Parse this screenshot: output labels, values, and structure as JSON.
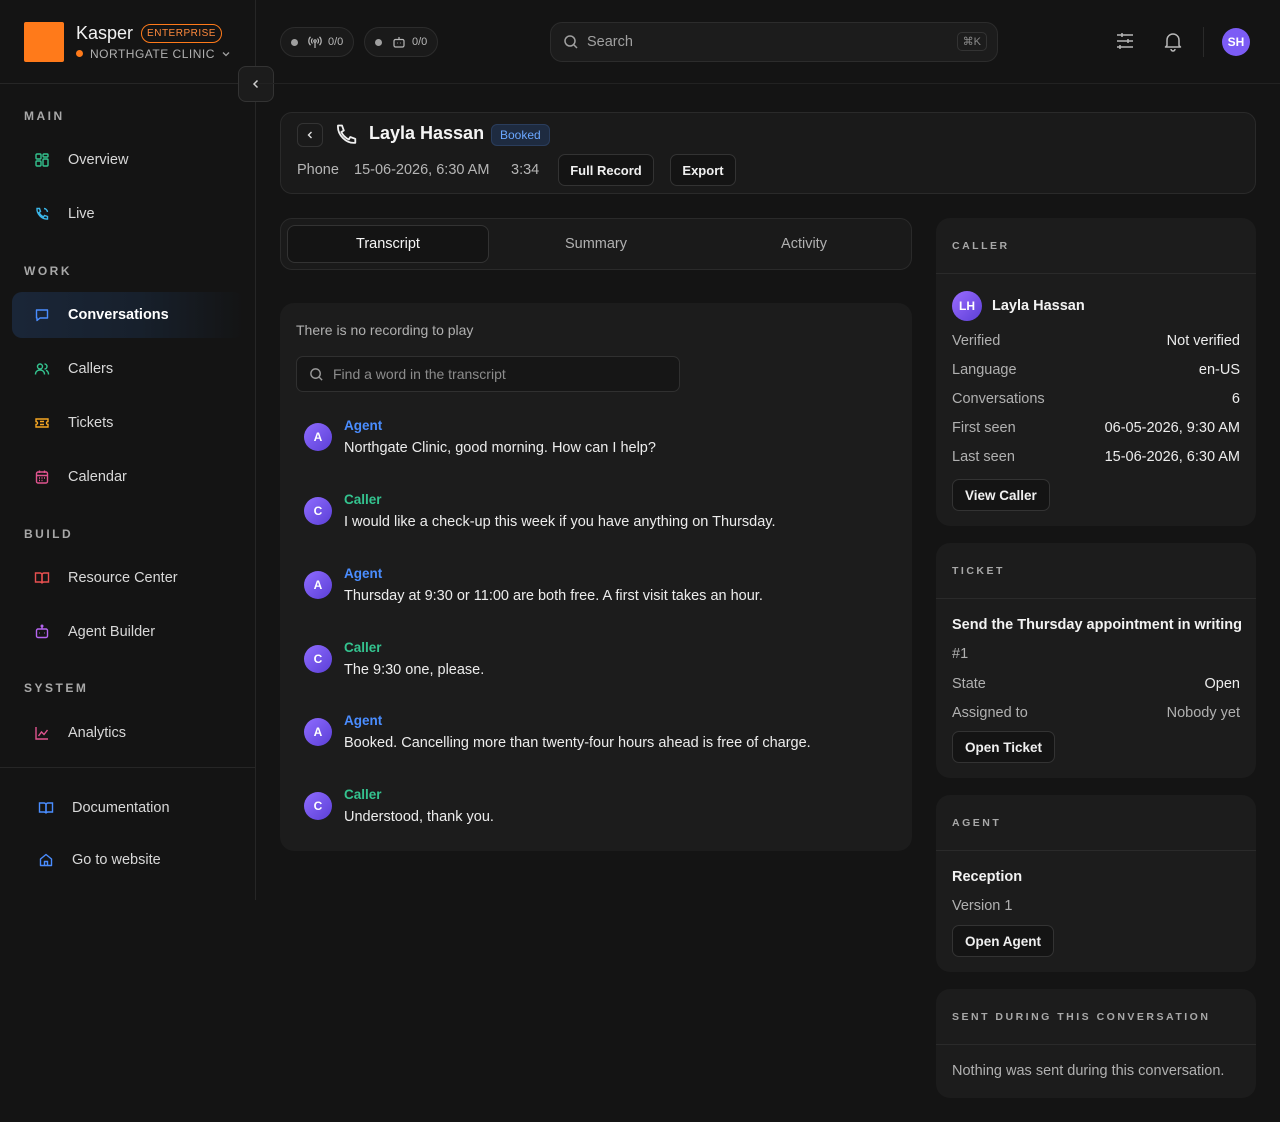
{
  "brand": {
    "name": "Kasper",
    "badge": "ENTERPRISE",
    "workspace": "NORTHGATE CLINIC"
  },
  "nav": {
    "sections": {
      "main": "MAIN",
      "work": "WORK",
      "build": "BUILD",
      "system": "SYSTEM"
    },
    "items": {
      "overview": "Overview",
      "live": "Live",
      "conversations": "Conversations",
      "callers": "Callers",
      "tickets": "Tickets",
      "calendar": "Calendar",
      "resource_center": "Resource Center",
      "agent_builder": "Agent Builder",
      "analytics": "Analytics",
      "documentation": "Documentation",
      "go_to_website": "Go to website"
    },
    "active": "conversations"
  },
  "topbar": {
    "calls_counter": "0/0",
    "agents_counter": "0/0",
    "search_placeholder": "Search",
    "search_shortcut": "⌘K",
    "user_initials": "SH"
  },
  "conversation": {
    "caller_name": "Layla Hassan",
    "status": "Booked",
    "channel": "Phone",
    "datetime": "15-06-2026, 6:30 AM",
    "duration": "3:34",
    "full_record_label": "Full Record",
    "export_label": "Export"
  },
  "tabs": [
    "Transcript",
    "Summary",
    "Activity"
  ],
  "transcript": {
    "no_recording": "There is no recording to play",
    "find_placeholder": "Find a word in the transcript",
    "messages": [
      {
        "initial": "A",
        "role": "Agent",
        "text": "Northgate Clinic, good morning. How can I help?"
      },
      {
        "initial": "C",
        "role": "Caller",
        "text": "I would like a check-up this week if you have anything on Thursday."
      },
      {
        "initial": "A",
        "role": "Agent",
        "text": "Thursday at 9:30 or 11:00 are both free. A first visit takes an hour."
      },
      {
        "initial": "C",
        "role": "Caller",
        "text": "The 9:30 one, please."
      },
      {
        "initial": "A",
        "role": "Agent",
        "text": "Booked. Cancelling more than twenty-four hours ahead is free of charge."
      },
      {
        "initial": "C",
        "role": "Caller",
        "text": "Understood, thank you."
      }
    ]
  },
  "caller_card": {
    "title": "CALLER",
    "initials": "LH",
    "name": "Layla Hassan",
    "rows": [
      {
        "k": "Verified",
        "v": "Not verified"
      },
      {
        "k": "Language",
        "v": "en-US"
      },
      {
        "k": "Conversations",
        "v": "6"
      },
      {
        "k": "First seen",
        "v": "06-05-2026, 9:30 AM"
      },
      {
        "k": "Last seen",
        "v": "15-06-2026, 6:30 AM"
      }
    ],
    "button": "View Caller"
  },
  "ticket_card": {
    "title": "TICKET",
    "subject": "Send the Thursday appointment in writing",
    "number": "#1",
    "rows": [
      {
        "k": "State",
        "v": "Open"
      },
      {
        "k": "Assigned to",
        "v": "Nobody yet"
      }
    ],
    "button": "Open Ticket"
  },
  "agent_card": {
    "title": "AGENT",
    "name": "Reception",
    "version": "Version 1",
    "button": "Open Agent"
  },
  "sent_card": {
    "title": "SENT DURING THIS CONVERSATION",
    "empty": "Nothing was sent during this conversation."
  },
  "colors": {
    "accent_orange": "#ff7a1a",
    "agent_blue": "#4a8dff",
    "caller_green": "#34c38f",
    "avatar_purple": "#7c5cf5"
  }
}
